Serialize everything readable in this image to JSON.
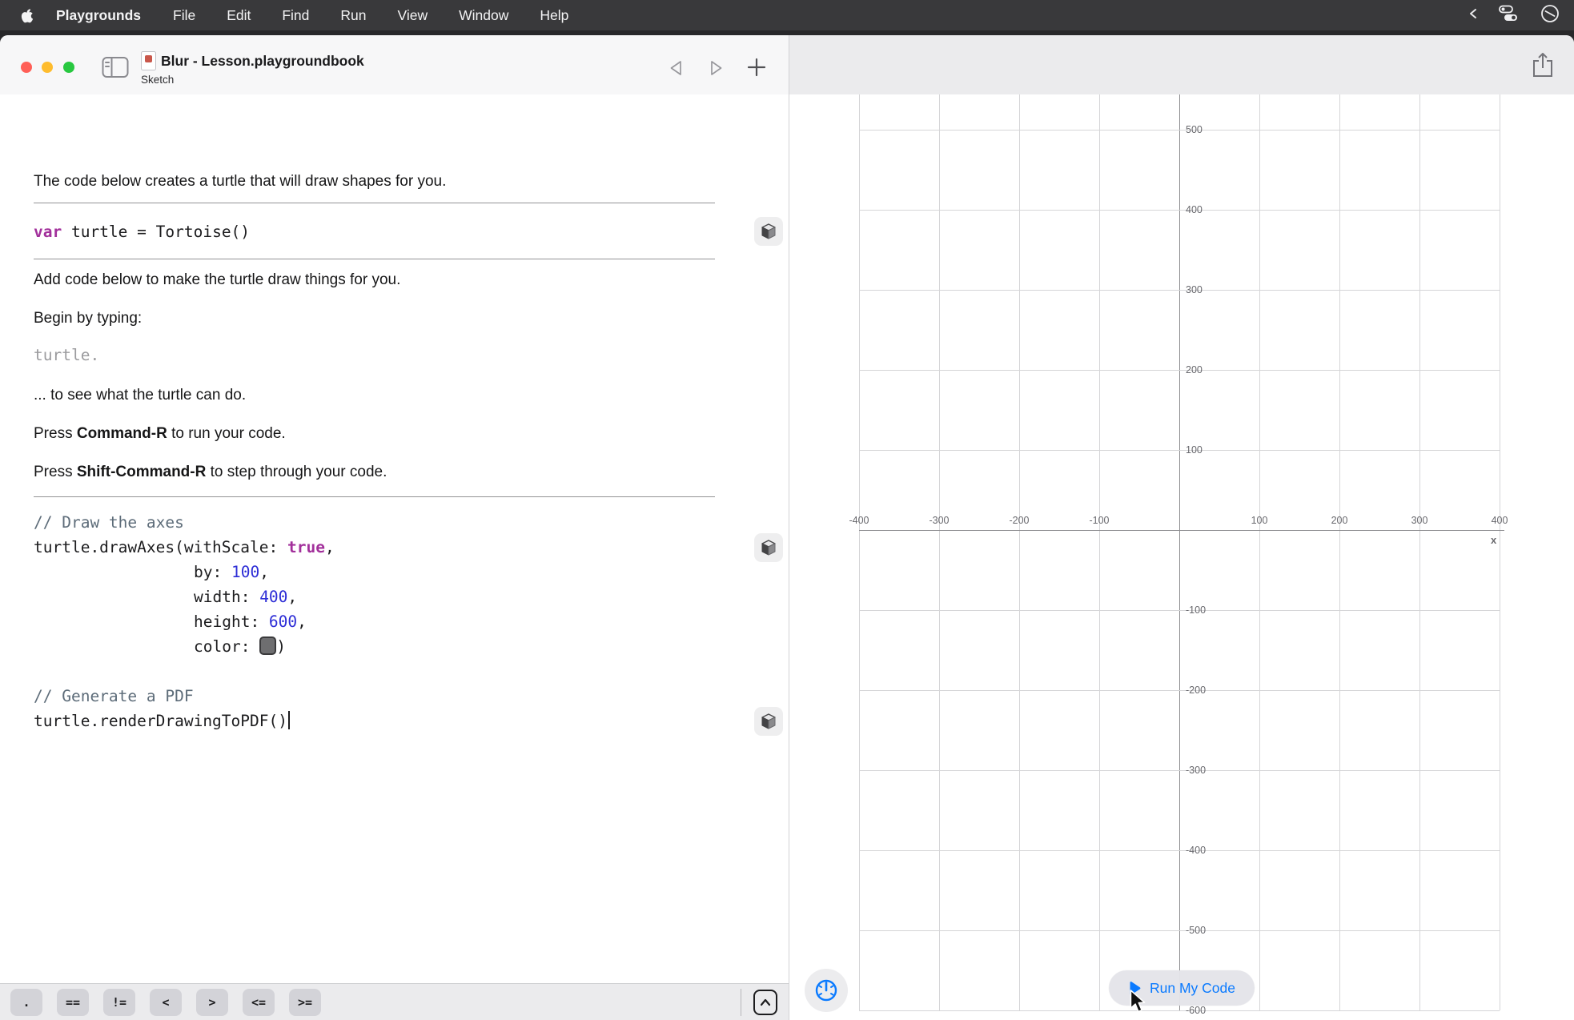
{
  "menubar": {
    "app_name": "Playgrounds",
    "items": [
      "File",
      "Edit",
      "Find",
      "Run",
      "View",
      "Window",
      "Help"
    ]
  },
  "window": {
    "title": "Blur - Lesson.playgroundbook",
    "subtitle": "Sketch"
  },
  "lesson": {
    "p1": "The code below creates a turtle that will draw shapes for you.",
    "p2": "Add code below to make the turtle draw things for you.",
    "p3": "Begin by typing:",
    "typing_hint": "turtle.",
    "p4": "... to see what the turtle can do.",
    "p5_pre": "Press ",
    "p5_key": "Command-R",
    "p5_post": " to run your code.",
    "p6_pre": "Press ",
    "p6_key": "Shift-Command-R",
    "p6_post": " to step through your code."
  },
  "code": {
    "decl_keyword": "var",
    "decl_rest": " turtle = Tortoise()",
    "axes_comment": "// Draw the axes",
    "axes_l1_pre": "turtle.drawAxes(withScale: ",
    "axes_l1_kw": "true",
    "axes_l1_post": ",",
    "axes_l2_label": "by: ",
    "axes_l2_num": "100",
    "axes_l2_post": ",",
    "axes_l3_label": "width: ",
    "axes_l3_num": "400",
    "axes_l3_post": ",",
    "axes_l4_label": "height: ",
    "axes_l4_num": "600",
    "axes_l4_post": ",",
    "axes_l5_label": "color: ",
    "axes_l5_post": ")",
    "pdf_comment": "// Generate a PDF",
    "pdf_line": "turtle.renderDrawingToPDF()"
  },
  "shortcut_bar": {
    "keys": [
      ".",
      "==",
      "!=",
      "<",
      ">",
      "<=",
      ">="
    ]
  },
  "canvas": {
    "x_ticks": [
      -400,
      -300,
      -200,
      -100,
      100,
      200,
      300,
      400
    ],
    "y_ticks": [
      500,
      400,
      300,
      200,
      100,
      -100,
      -200,
      -300,
      -400,
      -500,
      -600
    ],
    "axis_label": "x",
    "run_button_label": "Run My Code"
  },
  "colors": {
    "accent_blue": "#0a7aff",
    "keyword_pink": "#a2309b",
    "number_blue": "#2d2dd6",
    "comment_slate": "#5d6c79"
  }
}
